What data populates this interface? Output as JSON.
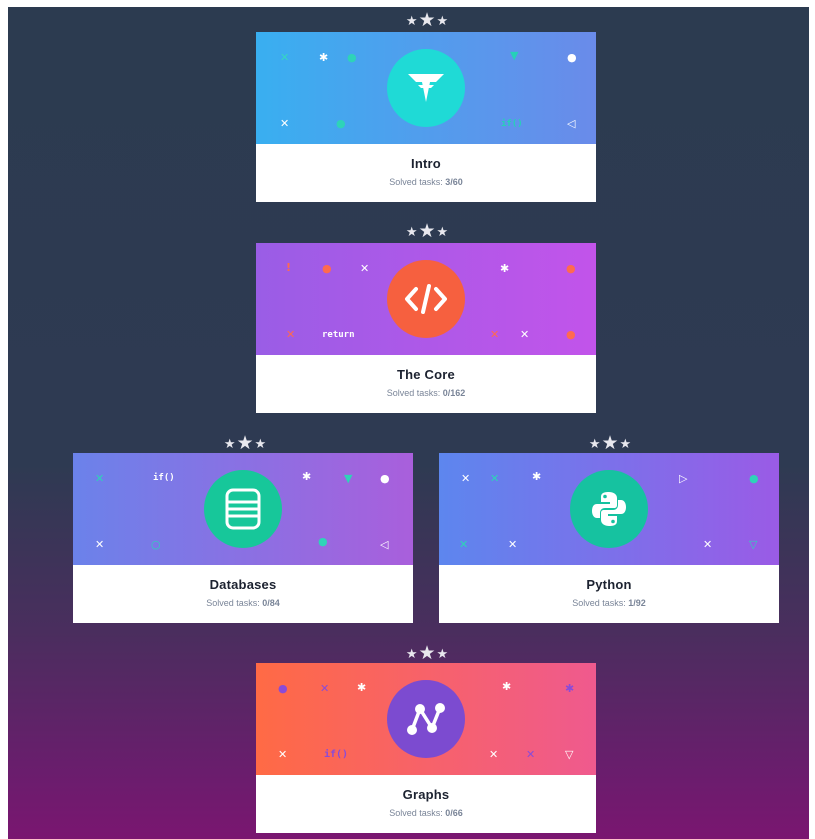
{
  "cards": [
    {
      "id": "intro",
      "title": "Intro",
      "solved_label": "Solved tasks:",
      "solved_value": "3/60",
      "icon": "codefights-logo-icon",
      "banner_from": "#39aff0",
      "banner_to": "#6a8bea",
      "circle_color": "#1fdad6",
      "decorations": [
        "✕",
        "✱",
        "●",
        "▼",
        "●",
        "✕",
        "●",
        "if()",
        "◁"
      ]
    },
    {
      "id": "the-core",
      "title": "The Core",
      "solved_label": "Solved tasks:",
      "solved_value": "0/162",
      "icon": "code-brackets-icon",
      "banner_from": "#9a5de6",
      "banner_to": "#c254ea",
      "circle_color": "#f6603f",
      "decorations": [
        "!",
        "●",
        "✕",
        "✱",
        "●",
        "✕",
        "return",
        "✕",
        "✕",
        "●"
      ]
    },
    {
      "id": "databases",
      "title": "Databases",
      "solved_label": "Solved tasks:",
      "solved_value": "0/84",
      "icon": "database-icon",
      "banner_from": "#6b82ea",
      "banner_to": "#a95fdc",
      "circle_color": "#17c79a",
      "decorations": [
        "✕",
        "if()",
        "✱",
        "▼",
        "●",
        "✕",
        "○",
        "●",
        "◁"
      ]
    },
    {
      "id": "python",
      "title": "Python",
      "solved_label": "Solved tasks:",
      "solved_value": "1/92",
      "icon": "python-logo-icon",
      "banner_from": "#5d86ee",
      "banner_to": "#9a5be6",
      "circle_color": "#16c2a0",
      "decorations": [
        "✕",
        "✕",
        "✱",
        "▷",
        "●",
        "✕",
        "✕",
        "✕",
        "▽"
      ]
    },
    {
      "id": "graphs",
      "title": "Graphs",
      "solved_label": "Solved tasks:",
      "solved_value": "0/66",
      "icon": "graph-nodes-icon",
      "banner_from": "#ff6a45",
      "banner_to": "#ef5a8e",
      "circle_color": "#7c4bd0",
      "decorations": [
        "●",
        "✕",
        "✱",
        "✱",
        "✱",
        "✕",
        "if()",
        "✕",
        "✕",
        "▽"
      ]
    }
  ]
}
